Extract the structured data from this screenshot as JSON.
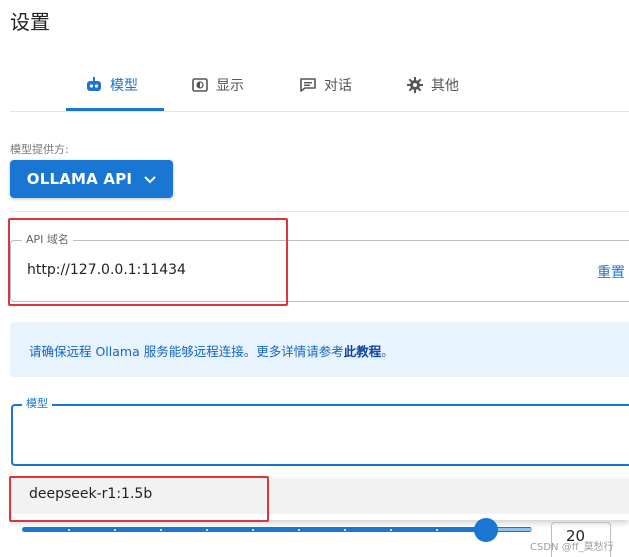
{
  "page": {
    "title": "设置"
  },
  "tabs": [
    {
      "label": "模型",
      "icon": "robot-icon",
      "active": true
    },
    {
      "label": "显示",
      "icon": "display-icon",
      "active": false
    },
    {
      "label": "对话",
      "icon": "chat-icon",
      "active": false
    },
    {
      "label": "其他",
      "icon": "gear-icon",
      "active": false
    }
  ],
  "provider": {
    "label": "模型提供方:",
    "value": "OLLAMA API"
  },
  "api": {
    "legend": "API 域名",
    "value": "http://127.0.0.1:11434",
    "reset_label": "重置"
  },
  "info": {
    "text": "请确保远程 Ollama 服务能够远程连接。更多详情请参考",
    "link": "此教程",
    "suffix": "。"
  },
  "model": {
    "legend": "模型",
    "value": "",
    "options": [
      "deepseek-r1:1.5b"
    ]
  },
  "slider": {
    "value": "20"
  },
  "watermark": "CSDN @ff_莫愁行",
  "colors": {
    "accent": "#1976d2",
    "highlight": "#d9363e",
    "info_bg": "#e8f4fd"
  }
}
